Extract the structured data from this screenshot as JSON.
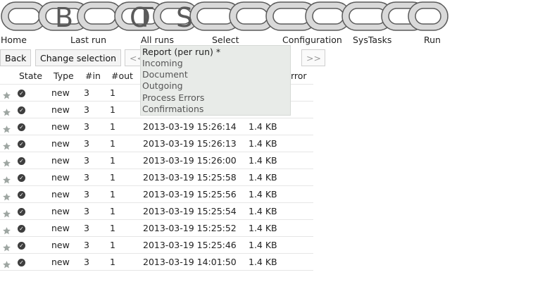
{
  "logo": {
    "letters": [
      "B",
      "O",
      "T",
      "S"
    ]
  },
  "menu": [
    {
      "label": "Home"
    },
    {
      "label": "Last run"
    },
    {
      "label": "All runs"
    },
    {
      "label": "Select"
    },
    {
      "label": "Configuration"
    },
    {
      "label": "SysTasks"
    },
    {
      "label": "Run"
    }
  ],
  "toolbar": {
    "back_label": "Back",
    "change_selection_label": "Change selection",
    "prev_label": "<<",
    "next_label": ">>"
  },
  "dropdown": {
    "items": [
      "Report (per run) *",
      "Incoming",
      "Document",
      "Outgoing",
      "Process Errors",
      "Confirmations"
    ]
  },
  "table": {
    "headers": {
      "state": "State",
      "type": "Type",
      "in": "#in",
      "out": "#out",
      "error": "rror"
    },
    "rows": [
      {
        "type": "new",
        "in": "3",
        "out": "1",
        "datetime": "",
        "size": ""
      },
      {
        "type": "new",
        "in": "3",
        "out": "1",
        "datetime": "",
        "size": ""
      },
      {
        "type": "new",
        "in": "3",
        "out": "1",
        "datetime": "2013-03-19 15:26:14",
        "size": "1.4 KB"
      },
      {
        "type": "new",
        "in": "3",
        "out": "1",
        "datetime": "2013-03-19 15:26:13",
        "size": "1.4 KB"
      },
      {
        "type": "new",
        "in": "3",
        "out": "1",
        "datetime": "2013-03-19 15:26:00",
        "size": "1.4 KB"
      },
      {
        "type": "new",
        "in": "3",
        "out": "1",
        "datetime": "2013-03-19 15:25:58",
        "size": "1.4 KB"
      },
      {
        "type": "new",
        "in": "3",
        "out": "1",
        "datetime": "2013-03-19 15:25:56",
        "size": "1.4 KB"
      },
      {
        "type": "new",
        "in": "3",
        "out": "1",
        "datetime": "2013-03-19 15:25:54",
        "size": "1.4 KB"
      },
      {
        "type": "new",
        "in": "3",
        "out": "1",
        "datetime": "2013-03-19 15:25:52",
        "size": "1.4 KB"
      },
      {
        "type": "new",
        "in": "3",
        "out": "1",
        "datetime": "2013-03-19 15:25:46",
        "size": "1.4 KB"
      },
      {
        "type": "new",
        "in": "3",
        "out": "1",
        "datetime": "2013-03-19 14:01:50",
        "size": "1.4 KB"
      }
    ]
  },
  "icons": {
    "row_star": "star-icon",
    "row_state": "check-circle-icon"
  },
  "colors": {
    "chain_fill": "#d9d9d9",
    "chain_stroke": "#5a5a5a",
    "dropdown_bg": "#e8ebe8"
  }
}
